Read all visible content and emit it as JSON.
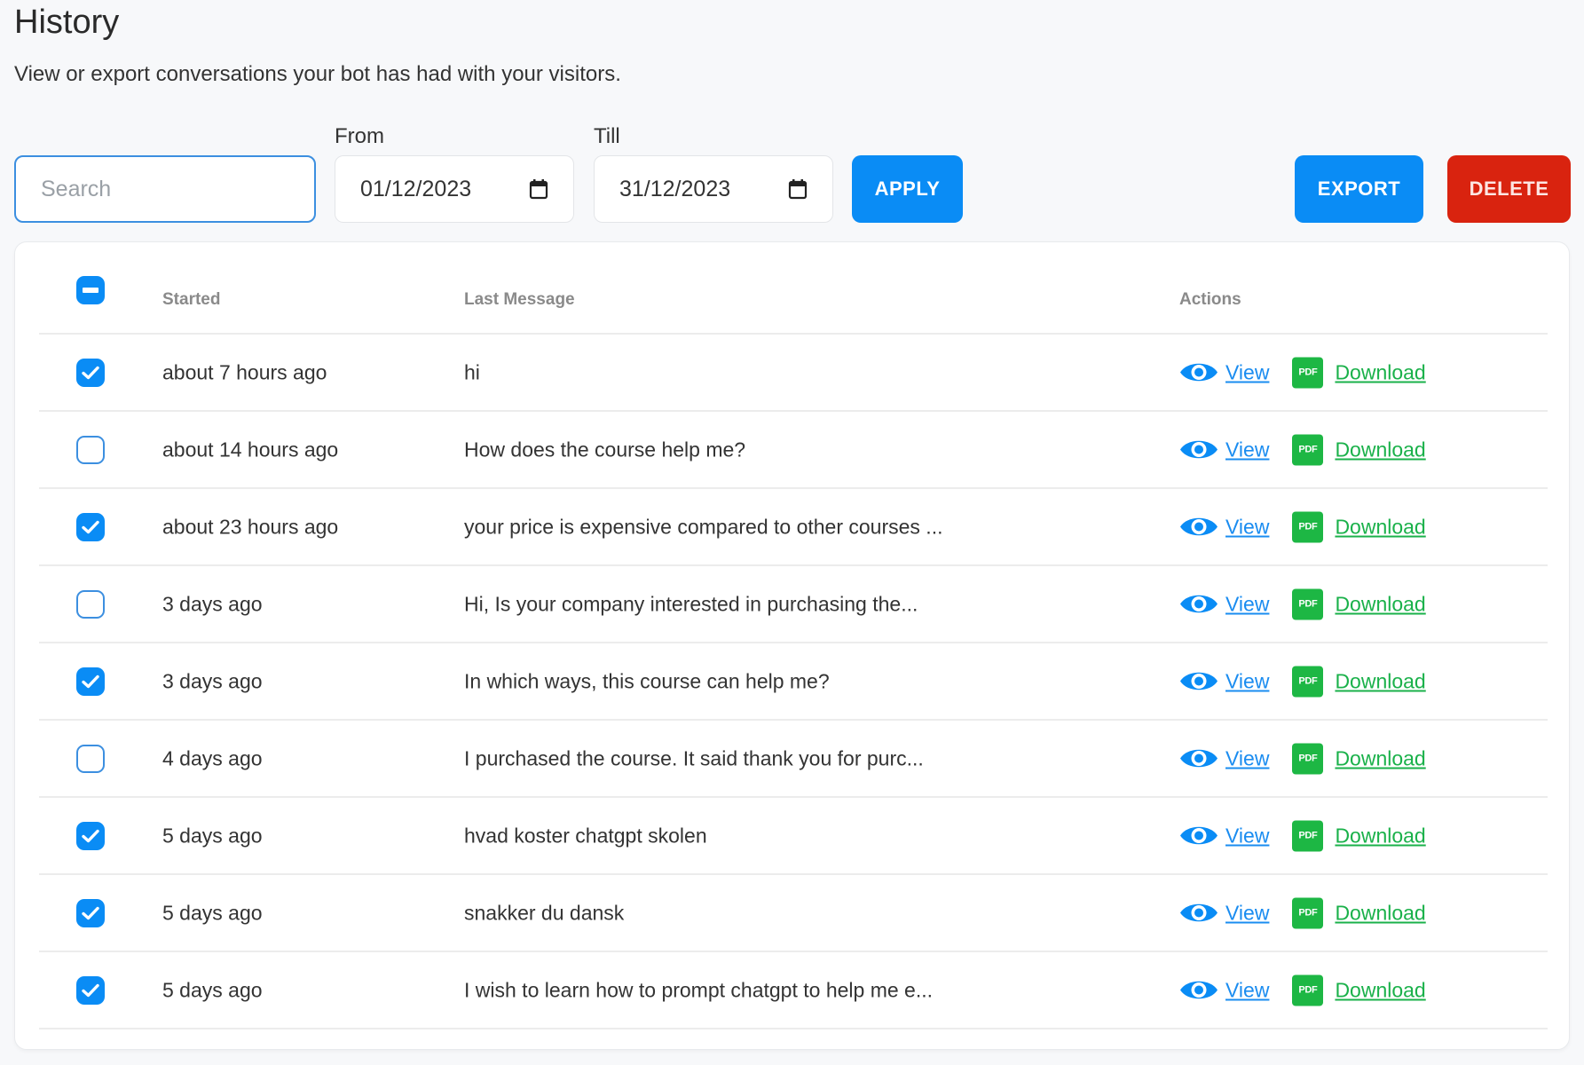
{
  "header": {
    "title": "History",
    "subtitle": "View or export conversations your bot has had with your visitors."
  },
  "filters": {
    "search_placeholder": "Search",
    "search_value": "",
    "from_label": "From",
    "from_value": "01/12/2023",
    "till_label": "Till",
    "till_value": "31/12/2023",
    "apply_label": "APPLY",
    "export_label": "EXPORT",
    "delete_label": "DELETE"
  },
  "colors": {
    "primary": "#0a8cf5",
    "danger": "#d9230f",
    "pdf_green": "#1db744",
    "download_green": "#1ab14a",
    "view_blue": "#1a8cf0"
  },
  "table": {
    "select_all_state": "indeterminate",
    "columns": [
      "Started",
      "Last Message",
      "Actions"
    ],
    "view_label": "View",
    "pdf_label": "PDF",
    "download_label": "Download",
    "rows": [
      {
        "checked": true,
        "started": "about 7 hours ago",
        "last_message": "hi"
      },
      {
        "checked": false,
        "started": "about 14 hours ago",
        "last_message": "How does the course help me?"
      },
      {
        "checked": true,
        "started": "about 23 hours ago",
        "last_message": "your price is expensive compared to other courses ..."
      },
      {
        "checked": false,
        "started": "3 days ago",
        "last_message": "Hi, Is your company interested in purchasing the..."
      },
      {
        "checked": true,
        "started": "3 days ago",
        "last_message": "In which ways, this course can help me?"
      },
      {
        "checked": false,
        "started": "4 days ago",
        "last_message": "I purchased the course. It said thank you for purc..."
      },
      {
        "checked": true,
        "started": "5 days ago",
        "last_message": "hvad koster chatgpt skolen"
      },
      {
        "checked": true,
        "started": "5 days ago",
        "last_message": "snakker du dansk"
      },
      {
        "checked": true,
        "started": "5 days ago",
        "last_message": "I wish to learn how to prompt chatgpt to help me e..."
      }
    ]
  }
}
